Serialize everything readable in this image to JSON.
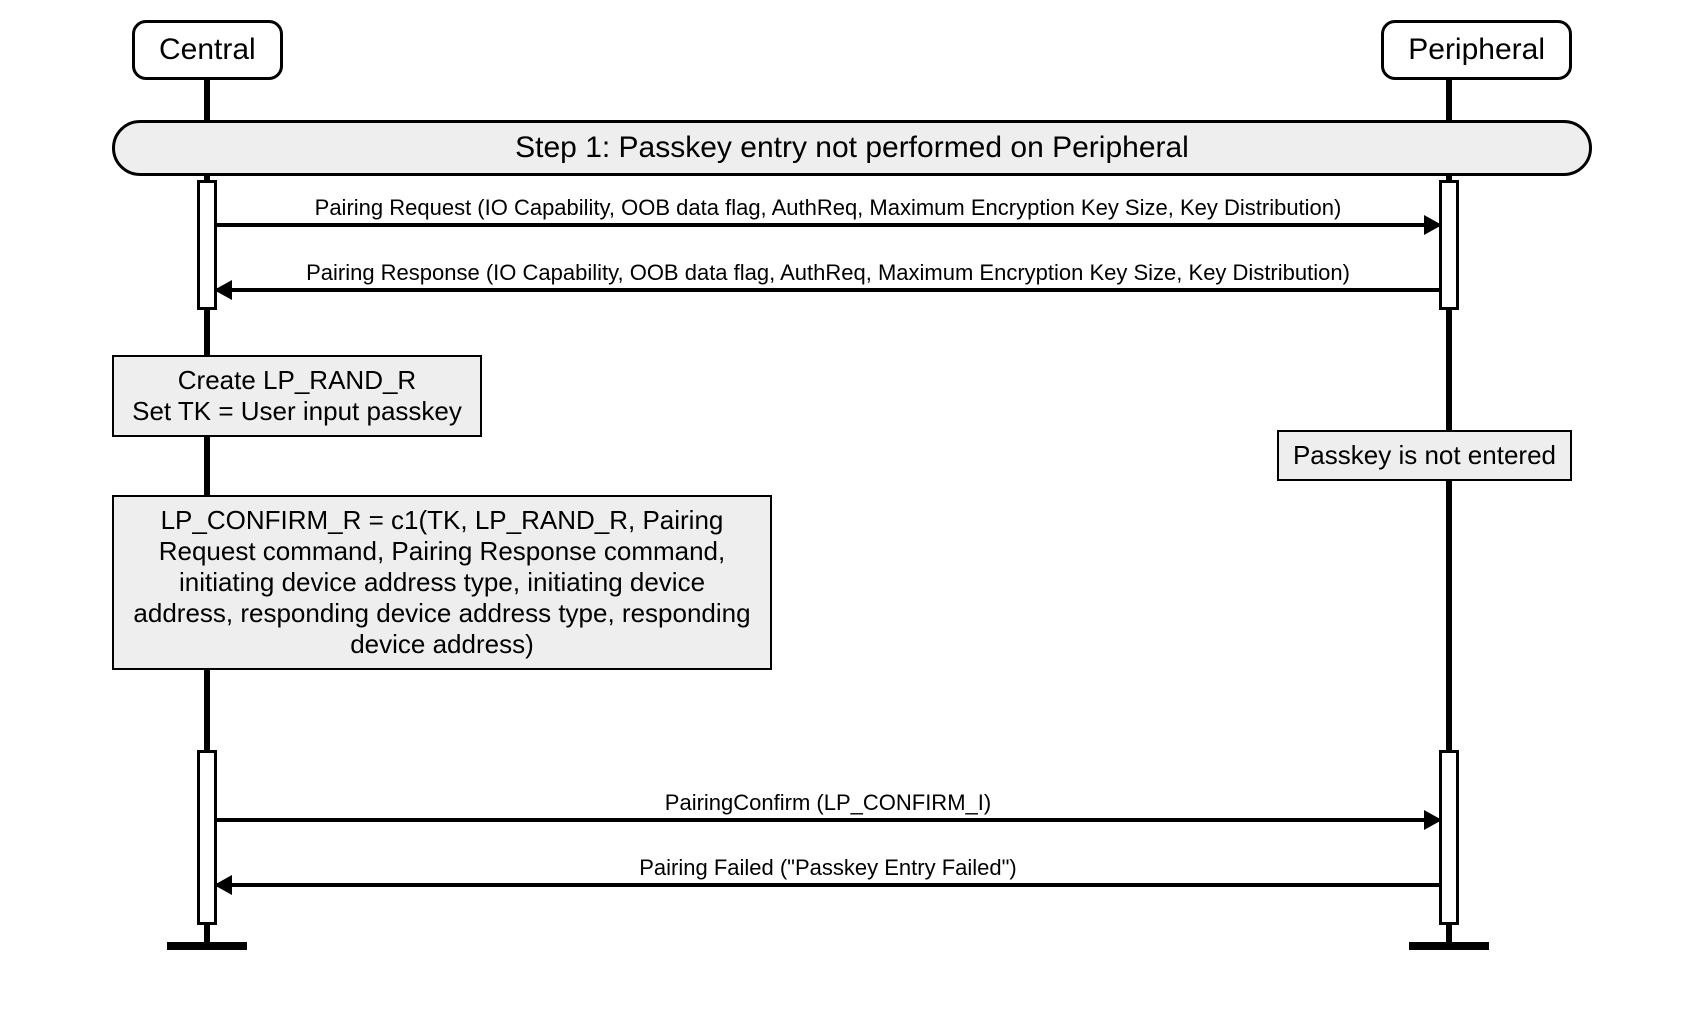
{
  "participants": {
    "left": "Central",
    "right": "Peripheral"
  },
  "step_banner": "Step 1: Passkey entry not performed on Peripheral",
  "messages": {
    "m1": "Pairing Request (IO Capability, OOB data flag, AuthReq, Maximum Encryption Key Size, Key Distribution)",
    "m2": "Pairing Response (IO Capability, OOB data flag, AuthReq, Maximum Encryption Key Size, Key Distribution)",
    "m3": "PairingConfirm (LP_CONFIRM_I)",
    "m4": "Pairing Failed (\"Passkey Entry Failed\")"
  },
  "notes": {
    "n1_line1": "Create LP_RAND_R",
    "n1_line2": "Set TK = User input passkey",
    "n2": "Passkey is not entered",
    "n3": "LP_CONFIRM_R = c1(TK, LP_RAND_R, Pairing Request command, Pairing Response command, initiating device address type, initiating device address, responding device address type, responding device address)"
  }
}
